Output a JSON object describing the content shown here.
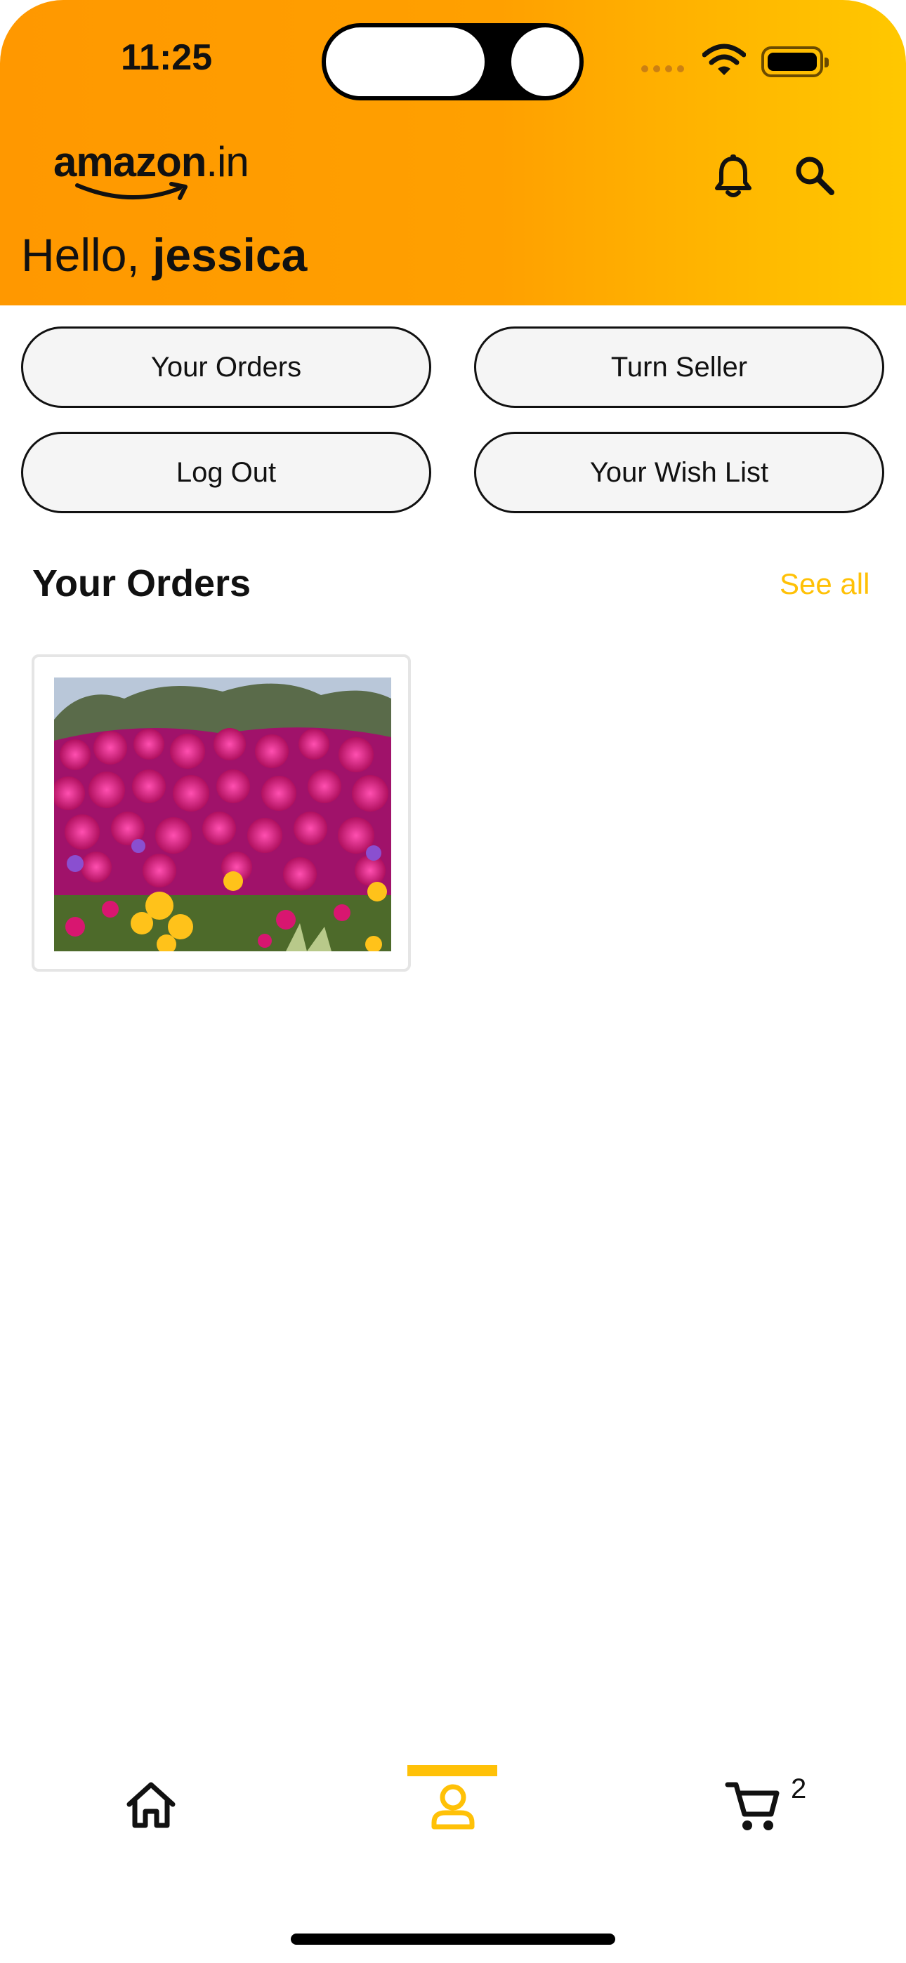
{
  "status_bar": {
    "time": "11:25"
  },
  "header": {
    "logo_text": "amazon",
    "logo_tld": ".in",
    "greeting_prefix": "Hello, ",
    "user_name": "jessica"
  },
  "actions": {
    "your_orders": "Your Orders",
    "turn_seller": "Turn Seller",
    "log_out": "Log Out",
    "wish_list": "Your Wish List"
  },
  "orders_section": {
    "title": "Your Orders",
    "see_all": "See all"
  },
  "bottom_nav": {
    "active_tab": "account",
    "cart_count": "2"
  },
  "colors": {
    "header_gradient_start": "#ff9800",
    "header_gradient_end": "#ffc800",
    "accent": "#ffc107"
  },
  "icons": [
    "bell-icon",
    "search-icon",
    "home-icon",
    "account-icon",
    "cart-icon",
    "wifi-icon",
    "battery-icon"
  ]
}
